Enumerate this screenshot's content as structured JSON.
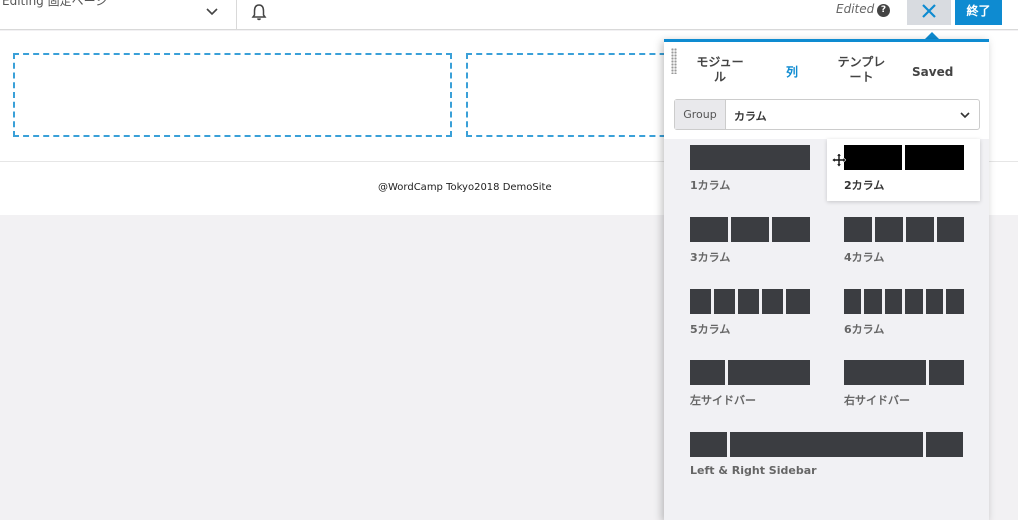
{
  "topbar": {
    "editing_text": "Editing 固定ページ",
    "status": "Edited",
    "help_glyph": "?",
    "done_label": "終了"
  },
  "content": {
    "copyright": "@WordCamp Tokyo2018 DemoSite"
  },
  "panel": {
    "tabs": [
      {
        "label": "モジュー\nル",
        "active": false
      },
      {
        "label": "列",
        "active": true
      },
      {
        "label": "テンプレ\nート",
        "active": false
      },
      {
        "label": "Saved",
        "active": false
      }
    ],
    "group_label": "Group",
    "group_value": "カラム",
    "layouts": [
      {
        "label": "1カラム"
      },
      {
        "label": "2カラム"
      },
      {
        "label": "3カラム"
      },
      {
        "label": "4カラム"
      },
      {
        "label": "5カラム"
      },
      {
        "label": "6カラム"
      },
      {
        "label": "左サイドバー"
      },
      {
        "label": "右サイドバー"
      },
      {
        "label": "Left & Right Sidebar"
      }
    ]
  },
  "colors": {
    "accent": "#0e8bd1",
    "block": "#3b3d41",
    "dashed": "#3aa0d8"
  }
}
